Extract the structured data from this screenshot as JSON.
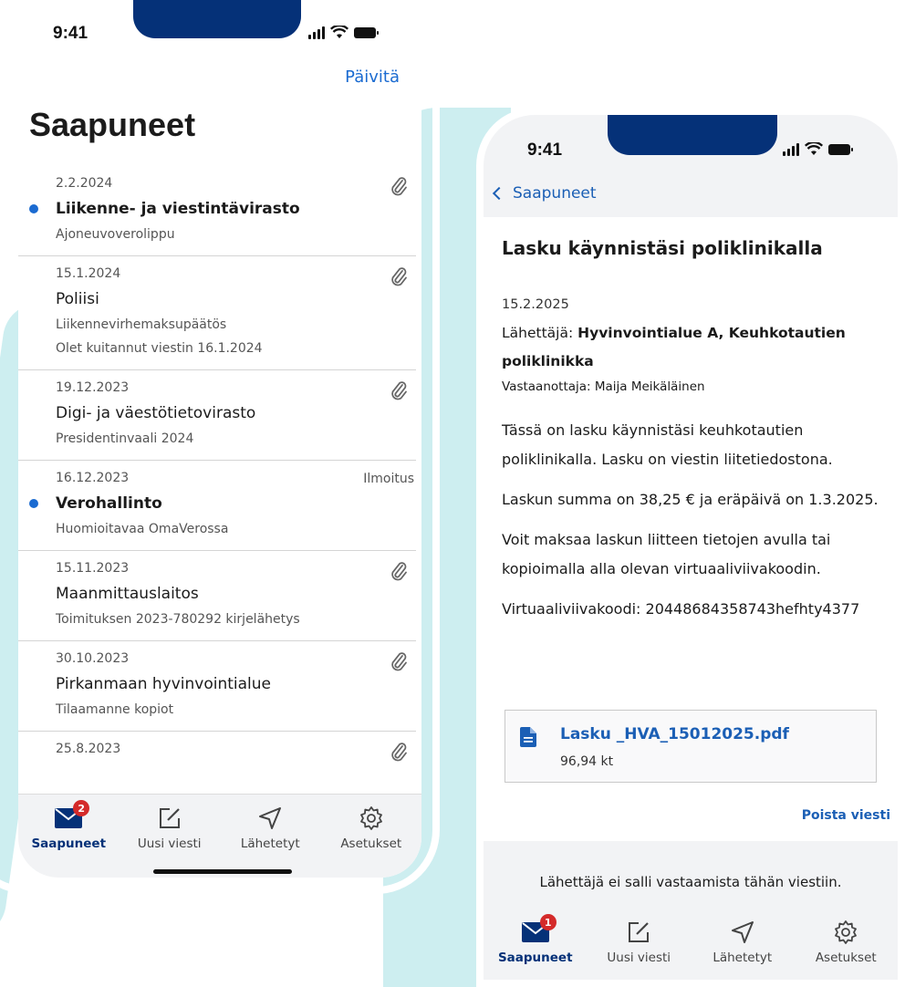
{
  "left_phone": {
    "status_time": "9:41",
    "refresh_label": "Päivitä",
    "title": "Saapuneet",
    "messages": [
      {
        "date": "2.2.2024",
        "sender": "Liikenne- ja viestintävirasto",
        "line1": "Ajoneuvoverolippu",
        "line2": "",
        "unread": true,
        "attachment": true,
        "tag": ""
      },
      {
        "date": "15.1.2024",
        "sender": "Poliisi",
        "line1": "Liikennevirhemaksupäätös",
        "line2": "Olet kuitannut viestin 16.1.2024",
        "unread": false,
        "attachment": true,
        "tag": ""
      },
      {
        "date": "19.12.2023",
        "sender": "Digi- ja väestötietovirasto",
        "line1": "Presidentinvaali 2024",
        "line2": "",
        "unread": false,
        "attachment": true,
        "tag": ""
      },
      {
        "date": "16.12.2023",
        "sender": "Verohallinto",
        "line1": "Huomioitavaa OmaVerossa",
        "line2": "",
        "unread": true,
        "attachment": false,
        "tag": "Ilmoitus"
      },
      {
        "date": "15.11.2023",
        "sender": "Maanmittauslaitos",
        "line1": "Toimituksen 2023-780292 kirjelähetys",
        "line2": "",
        "unread": false,
        "attachment": true,
        "tag": ""
      },
      {
        "date": "30.10.2023",
        "sender": "Pirkanmaan hyvinvointialue",
        "line1": "Tilaamanne kopiot",
        "line2": "",
        "unread": false,
        "attachment": true,
        "tag": ""
      },
      {
        "date": "25.8.2023",
        "sender": "",
        "line1": "",
        "line2": "",
        "unread": false,
        "attachment": true,
        "tag": ""
      }
    ],
    "tabbar": {
      "inbox": "Saapuneet",
      "inbox_badge": "2",
      "new_message": "Uusi viesti",
      "sent": "Lähetetyt",
      "settings": "Asetukset"
    }
  },
  "right_phone": {
    "status_time": "9:41",
    "back_label": "Saapuneet",
    "title": "Lasku käynnistäsi poliklinikalla",
    "date": "15.2.2025",
    "sender_label": "Lähettäjä:",
    "sender_name": "Hyvinvointialue A, Keuhkotautien poliklinikka",
    "recipient": "Vastaanottaja: Maija Meikäläinen",
    "body": [
      "Tässä on lasku käynnistäsi keuhkotautien poliklinikalla. Lasku on viestin liitetiedostona.",
      "Laskun summa on 38,25 € ja eräpäivä on 1.3.2025.",
      "Voit maksaa laskun liitteen tietojen avulla tai kopioimalla alla olevan virtuaaliviivakoodin.",
      "Virtuaaliviivakoodi: 20448684358743hefhty4377"
    ],
    "attachment": {
      "name": "Lasku _HVA_15012025.pdf",
      "size": "96,94 kt"
    },
    "delete_label": "Poista viesti",
    "no_reply": "Lähettäjä ei salli vastaamista tähän viestiin.",
    "tabbar": {
      "inbox": "Saapuneet",
      "inbox_badge": "1",
      "new_message": "Uusi viesti",
      "sent": "Lähetetyt",
      "settings": "Asetukset"
    }
  },
  "colors": {
    "accent_blue": "#1b6bd1",
    "navy": "#053178",
    "badge_red": "#d42a2a",
    "backdrop_teal": "#cdeef0"
  }
}
